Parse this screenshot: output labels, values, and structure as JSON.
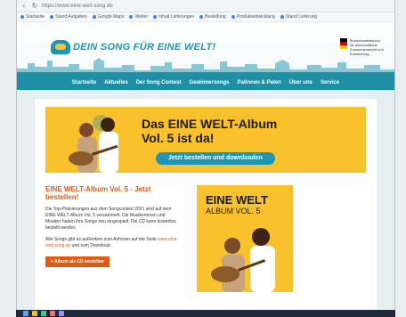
{
  "browser": {
    "url": "https://www.eine-welt-song.de",
    "bookmarks": [
      "Startseite",
      "Stand Aufgaben",
      "Google Maps",
      "Wetter",
      "Inhalt Lieferungen",
      "Bestellung",
      "Produktentwicklung",
      "Stand Lieferung"
    ]
  },
  "site": {
    "logo_text": "DEIN SONG FÜR EINE WELT!",
    "gov_text": "Bundesministerium für wirtschaftliche Zusammenarbeit und Entwicklung",
    "nav": [
      "Startseite",
      "Aktuelles",
      "Der Song Contest",
      "Gewinnersongs",
      "Patinnen & Paten",
      "Über uns",
      "Service"
    ]
  },
  "banner": {
    "title_line1": "Das EINE WELT-Album",
    "title_line2": "Vol. 5 ist da!",
    "button_label": "Jetzt bestellen und downloaden"
  },
  "article": {
    "title": "EINE WELT-Album Vol. 5 - Jetzt bestellen!",
    "paragraph1": "Die Top-Platzierungen aus dem Songcontest 2021 sind auf dem EINE WELT-Album Vol. 5 versammelt. Die Musikerinnen und Musiker haben ihre Songs neu eingespielt. Die CD kann kostenlos bestellt werden.",
    "paragraph2_start": "Alle Songs gibt es außerdem zum Anhören auf der Seite",
    "paragraph2_link": "www.eine-welt-song.de",
    "paragraph2_end": "und zum Download.",
    "cta_label": "> Album als CD bestellen"
  },
  "album_cover": {
    "title": "EINE WELT",
    "subtitle": "ALBUM VOL. 5"
  },
  "colors": {
    "accent_blue": "#1e95b3",
    "accent_yellow": "#f9c22c",
    "accent_orange": "#e05a12"
  }
}
